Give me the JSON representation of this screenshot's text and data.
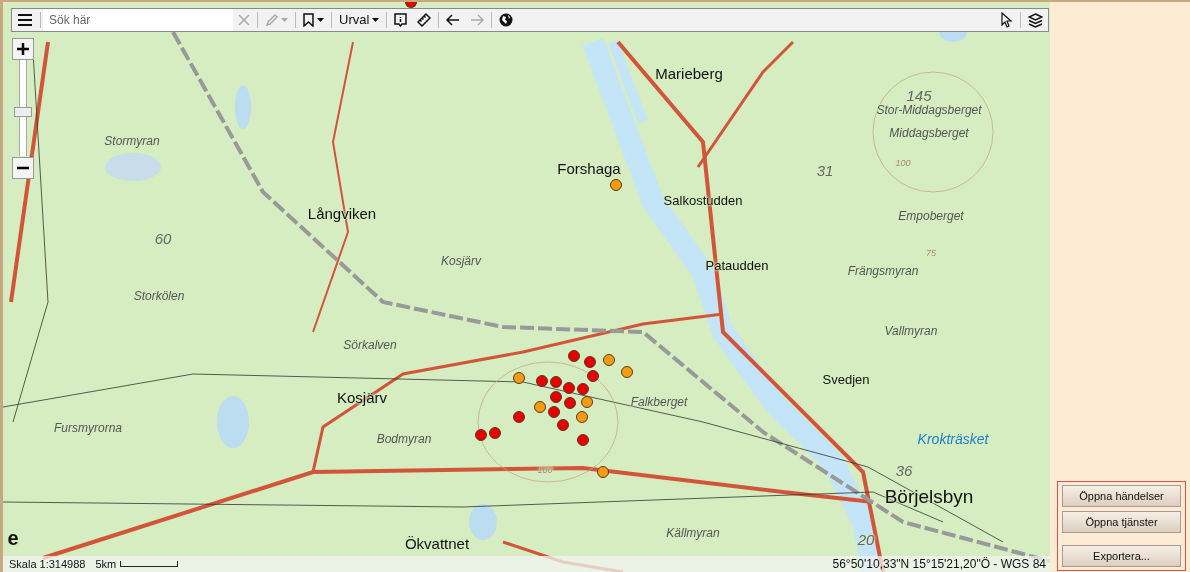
{
  "toolbar": {
    "search": {
      "placeholder": "Sök här"
    },
    "tools": [
      {
        "kind": "edit",
        "disabled": true
      },
      {
        "kind": "bookmark",
        "disabled": false
      },
      {
        "kind": "select",
        "label": "Urval",
        "disabled": false
      },
      {
        "kind": "info",
        "disabled": false
      },
      {
        "kind": "ruler",
        "disabled": false
      },
      {
        "kind": "back",
        "disabled": false
      },
      {
        "kind": "forward",
        "disabled": true
      },
      {
        "kind": "globe",
        "disabled": false
      }
    ]
  },
  "zoom": {
    "level": 0.45
  },
  "map_labels": [
    {
      "text": "Marieberg",
      "kind": "place"
    },
    {
      "text": "Forshaga",
      "kind": "place"
    },
    {
      "text": "Salkostudden",
      "kind": "locality"
    },
    {
      "text": "Pataudden",
      "kind": "locality"
    },
    {
      "text": "145",
      "kind": "number"
    },
    {
      "text": "Stor-Middagsberget",
      "kind": "area"
    },
    {
      "text": "Middagsberget",
      "kind": "area"
    },
    {
      "text": "31",
      "kind": "number"
    },
    {
      "text": "100",
      "kind": "contour"
    },
    {
      "text": "Empoberget",
      "kind": "area"
    },
    {
      "text": "75",
      "kind": "contour"
    },
    {
      "text": "Frängsmyran",
      "kind": "area"
    },
    {
      "text": "Vallmyran",
      "kind": "area"
    },
    {
      "text": "Svedjen",
      "kind": "locality"
    },
    {
      "text": "Krokträsket",
      "kind": "water"
    },
    {
      "text": "36",
      "kind": "number"
    },
    {
      "text": "Börjelsbyn",
      "kind": "town"
    },
    {
      "text": "20",
      "kind": "number"
    },
    {
      "text": "Källmyran",
      "kind": "area"
    },
    {
      "text": "Ökvattnet",
      "kind": "place"
    },
    {
      "text": "Kosjärv",
      "kind": "place"
    },
    {
      "text": "Bodmyran",
      "kind": "area"
    },
    {
      "text": "Falkberget",
      "kind": "area"
    },
    {
      "text": "100",
      "kind": "contour"
    },
    {
      "text": "Sörkalven",
      "kind": "area"
    },
    {
      "text": "Kosjärv",
      "kind": "area"
    },
    {
      "text": "Långviken",
      "kind": "place"
    },
    {
      "text": "Stormyran",
      "kind": "area"
    },
    {
      "text": "60",
      "kind": "number"
    },
    {
      "text": "Storkölen",
      "kind": "area"
    },
    {
      "text": "Fursmyrorna",
      "kind": "area"
    },
    {
      "text": "e",
      "kind": "edge"
    }
  ],
  "incidents": [
    {
      "color": "#f39c12"
    },
    {
      "color": "#f39c12"
    },
    {
      "color": "#f39c12"
    },
    {
      "color": "#f39c12"
    },
    {
      "color": "#f39c12"
    },
    {
      "color": "#f39c12"
    },
    {
      "color": "#f39c12"
    },
    {
      "color": "#f39c12"
    },
    {
      "color": "#e60000"
    },
    {
      "color": "#e60000"
    },
    {
      "color": "#e60000"
    },
    {
      "color": "#e60000"
    },
    {
      "color": "#e60000"
    },
    {
      "color": "#e60000"
    },
    {
      "color": "#e60000"
    },
    {
      "color": "#e60000"
    },
    {
      "color": "#e60000"
    },
    {
      "color": "#e60000"
    },
    {
      "color": "#e60000"
    },
    {
      "color": "#e60000"
    },
    {
      "color": "#e60000"
    },
    {
      "color": "#e60000"
    },
    {
      "color": "#e60000"
    },
    {
      "color": "#e60000"
    }
  ],
  "status": {
    "scale": "Skala 1:314988",
    "scale_bar": "5km",
    "coordinates": "56°50'10,33\"N 15°15'21,20\"Ö - WGS 84"
  },
  "actions": [
    "Öppna händelser",
    "Öppna tjänster",
    "Exportera..."
  ]
}
